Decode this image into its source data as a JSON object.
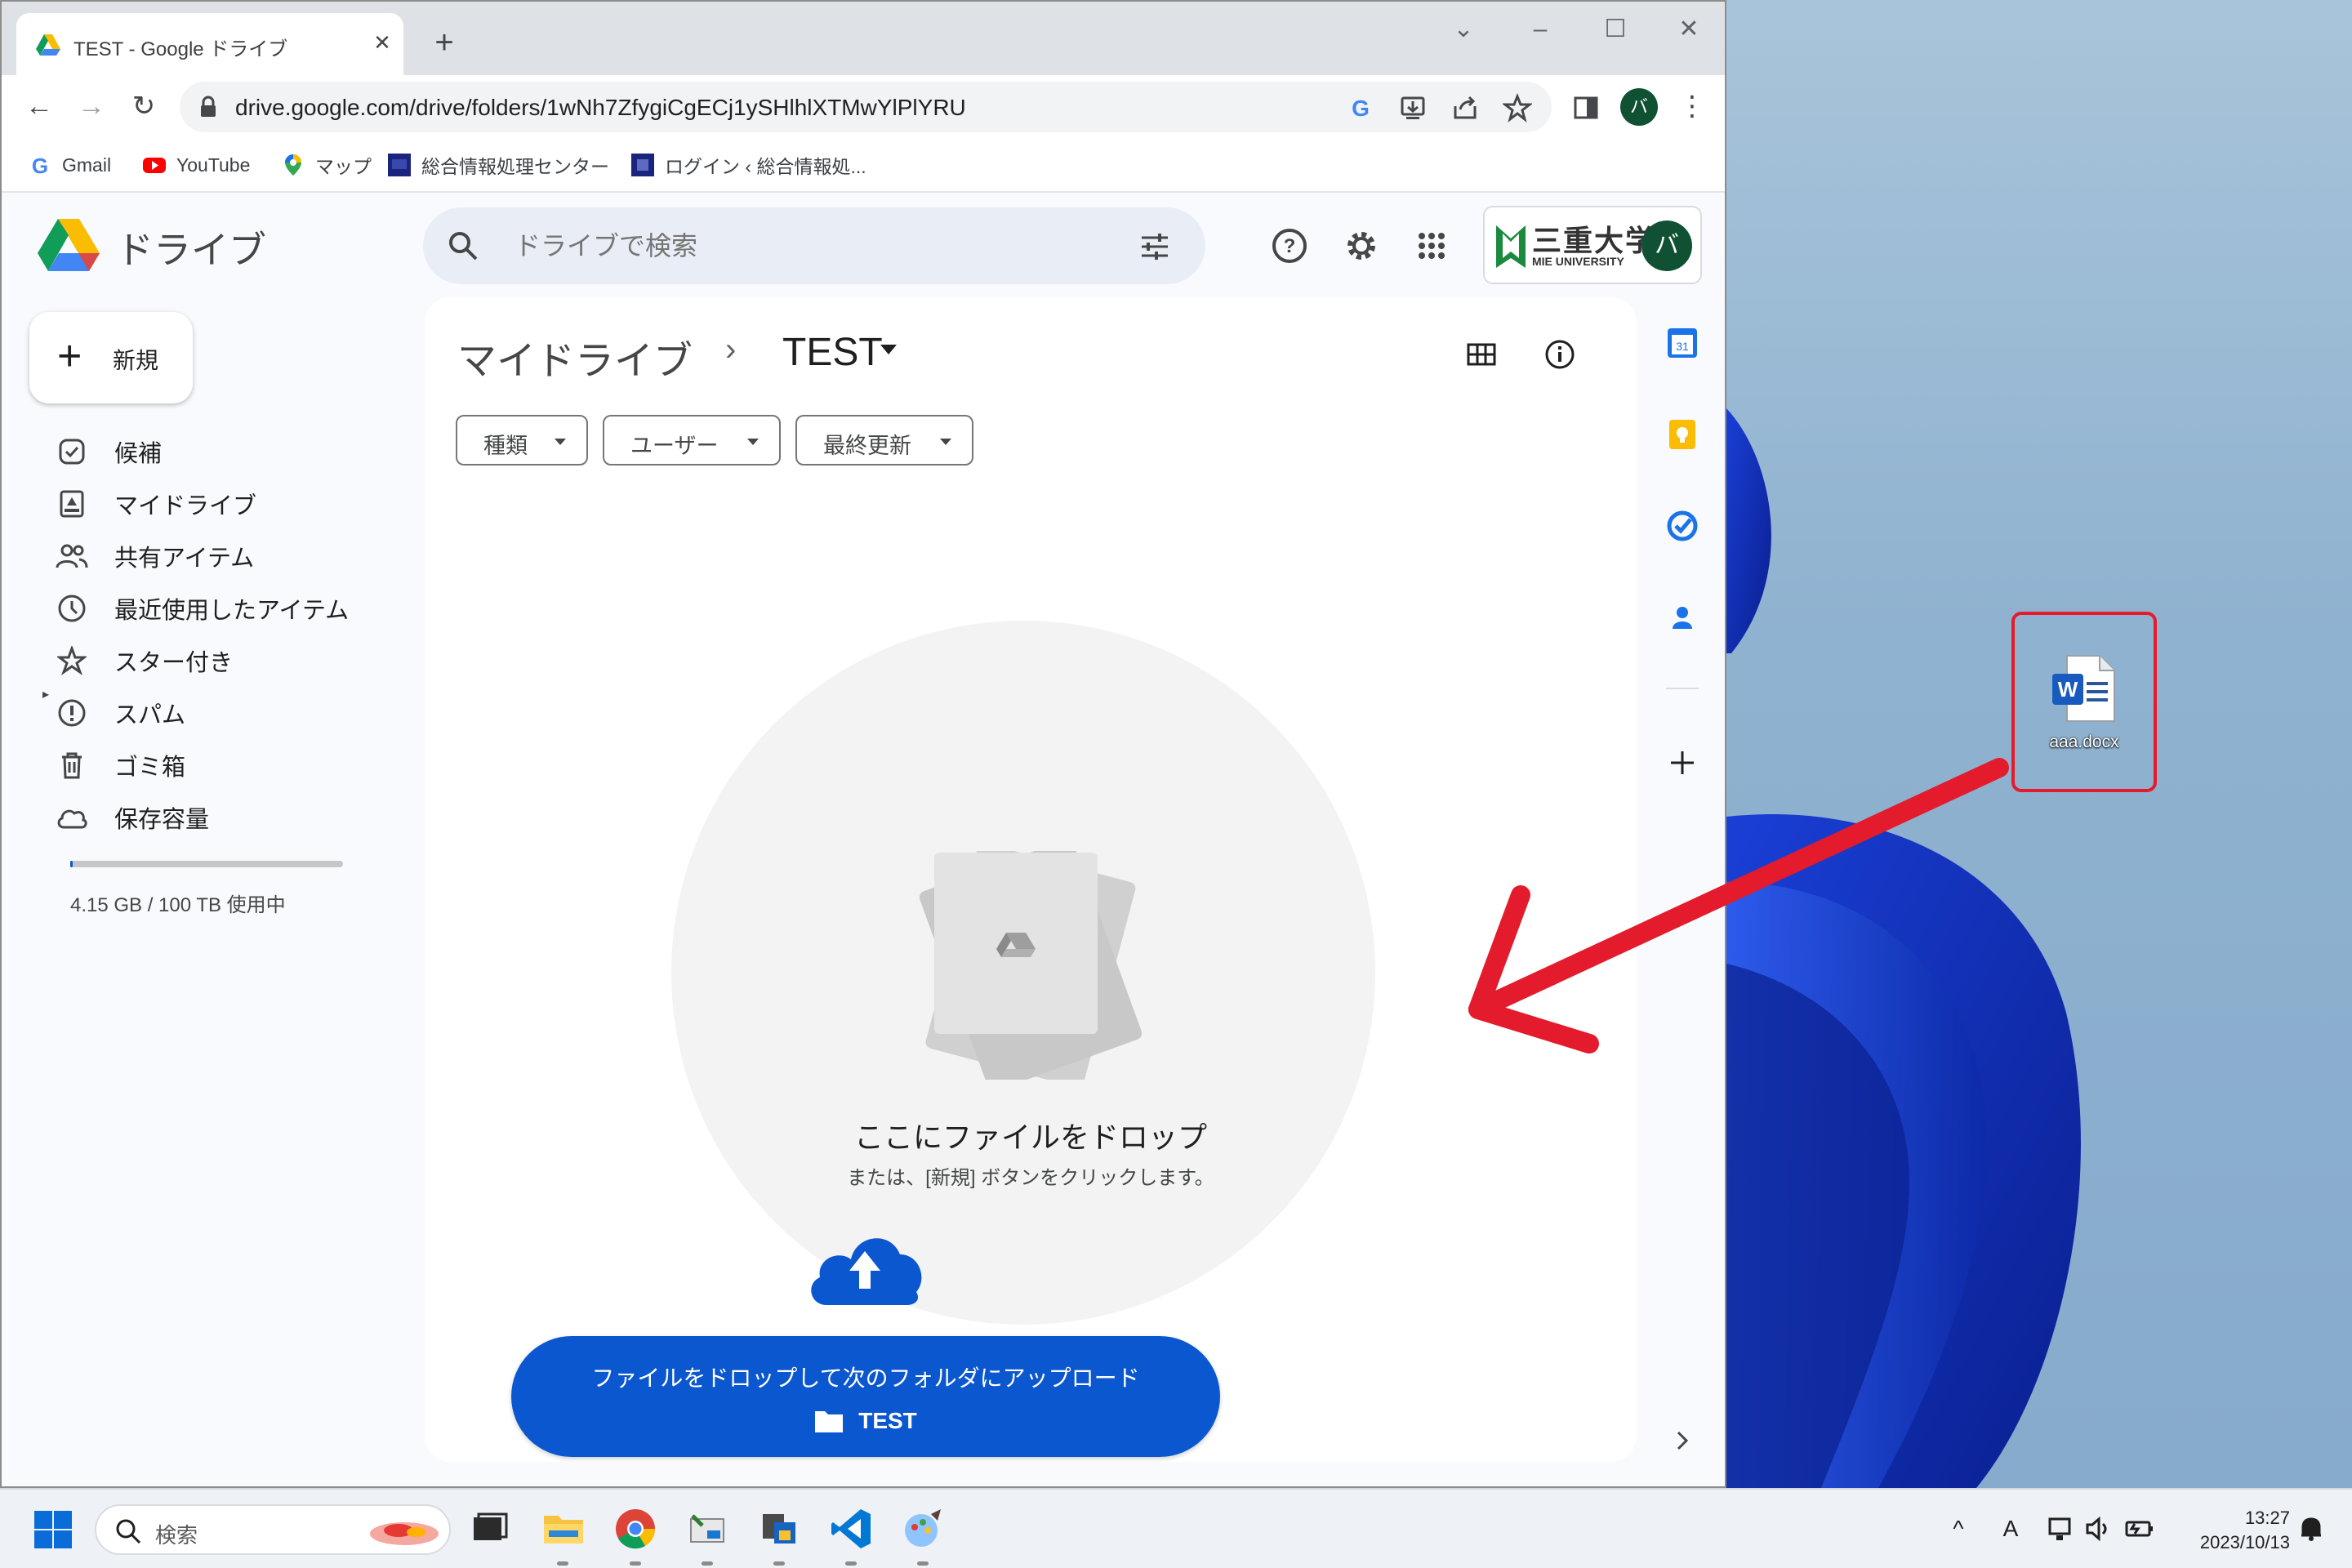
{
  "browser": {
    "tab_title": "TEST - Google ドライブ",
    "url": "drive.google.com/drive/folders/1wNh7ZfygiCgECj1ySHlhlXTMwYlPlYRU",
    "profile_initial": "バ",
    "bookmarks": [
      {
        "label": "Gmail"
      },
      {
        "label": "YouTube"
      },
      {
        "label": "マップ"
      },
      {
        "label": "総合情報処理センター"
      },
      {
        "label": "ログイン ‹ 総合情報処..."
      }
    ]
  },
  "drive": {
    "app_name": "ドライブ",
    "search_placeholder": "ドライブで検索",
    "org_name": "三重大学",
    "org_sub": "MIE UNIVERSITY",
    "avatar_initial": "バ",
    "new_label": "新規",
    "nav": [
      {
        "label": "候補",
        "icon": "check-circle-icon"
      },
      {
        "label": "マイドライブ",
        "icon": "my-drive-icon"
      },
      {
        "label": "共有アイテム",
        "icon": "people-icon"
      },
      {
        "label": "最近使用したアイテム",
        "icon": "clock-icon"
      },
      {
        "label": "スター付き",
        "icon": "star-icon"
      },
      {
        "label": "スパム",
        "icon": "spam-icon"
      },
      {
        "label": "ゴミ箱",
        "icon": "trash-icon"
      },
      {
        "label": "保存容量",
        "icon": "cloud-icon"
      }
    ],
    "storage_used": 4.15e-05,
    "storage_text": "4.15 GB / 100 TB 使用中",
    "breadcrumb_root": "マイドライブ",
    "breadcrumb_sep": "›",
    "breadcrumb_current": "TEST",
    "filters": [
      "種類",
      "ユーザー",
      "最終更新"
    ],
    "drop_title": "ここにファイルをドロップ",
    "drop_subtitle": "または、[新規] ボタンをクリックします。",
    "upload_banner_text": "ファイルをドロップして次のフォルダにアップロード",
    "upload_folder": "TEST",
    "accent_color": "#0b57d0"
  },
  "desktop": {
    "file_name": "aaa.docx",
    "highlight_color": "#e31b2c"
  },
  "taskbar": {
    "search_label": "検索",
    "time": "13:27",
    "date": "2023/10/13",
    "ime": "A"
  }
}
